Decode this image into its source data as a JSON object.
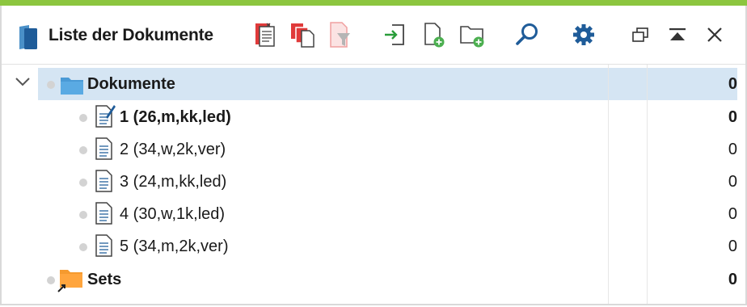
{
  "window": {
    "title": "Liste der Dokumente",
    "accent_color": "#8cc63f",
    "selection_color": "#d5e5f3"
  },
  "toolbar": {
    "buttons": [
      {
        "name": "activate-all-icon"
      },
      {
        "name": "copy-documents-icon"
      },
      {
        "name": "filter-icon"
      },
      {
        "name": "import-icon"
      },
      {
        "name": "new-document-icon"
      },
      {
        "name": "new-folder-icon"
      },
      {
        "name": "search-icon"
      },
      {
        "name": "settings-icon"
      }
    ],
    "window_controls": [
      "restore-window-icon",
      "collapse-icon",
      "close-icon"
    ]
  },
  "tree": {
    "root": {
      "label": "Dokumente",
      "count": "0",
      "icon": "blue-folder-icon"
    },
    "documents": [
      {
        "label": "1 (26,m,kk,led)",
        "count": "0",
        "bold": true,
        "icon": "edited-document-icon"
      },
      {
        "label": "2 (34,w,2k,ver)",
        "count": "0",
        "bold": false,
        "icon": "document-icon"
      },
      {
        "label": "3 (24,m,kk,led)",
        "count": "0",
        "bold": false,
        "icon": "document-icon"
      },
      {
        "label": "4 (30,w,1k,led)",
        "count": "0",
        "bold": false,
        "icon": "document-icon"
      },
      {
        "label": "5 (34,m,2k,ver)",
        "count": "0",
        "bold": false,
        "icon": "document-icon"
      }
    ],
    "sets": {
      "label": "Sets",
      "count": "0",
      "icon": "orange-folder-shortcut-icon"
    }
  }
}
